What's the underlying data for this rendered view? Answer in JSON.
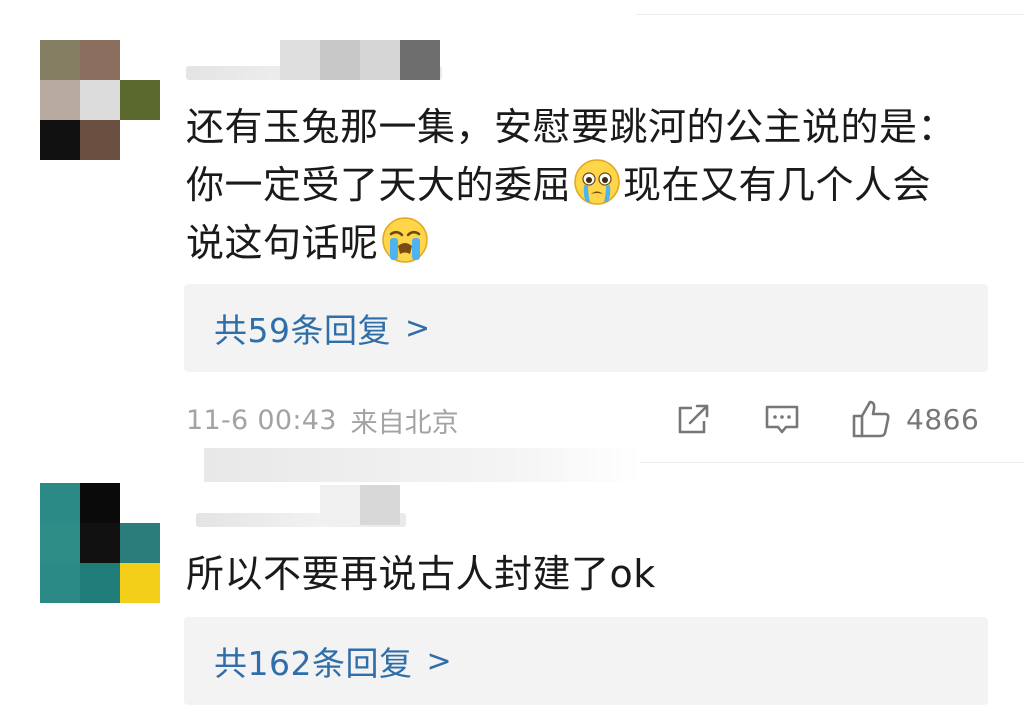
{
  "comments": [
    {
      "text_parts": {
        "line1": "还有玉兔那一集，安慰要跳河的公主说的是：",
        "line2a": "你一定受了天大的委屈",
        "line2b": "现在又有几个人会",
        "line3": "说这句话呢"
      },
      "emojis": [
        "crying-face-emoji",
        "loudly-crying-face-emoji"
      ],
      "reply_label": "共59条回复",
      "reply_chevron": ">",
      "timestamp": "11-6 00:43",
      "location": "来自北京",
      "like_count": "4866",
      "icons": [
        "share-icon",
        "comment-icon",
        "thumbs-up-icon"
      ]
    },
    {
      "text": "所以不要再说古人封建了ok",
      "reply_label": "共162条回复",
      "reply_chevron": ">"
    }
  ],
  "colors": {
    "link": "#2f6ea8",
    "meta": "#a3a3a3",
    "reply_bg": "#f3f3f3"
  }
}
